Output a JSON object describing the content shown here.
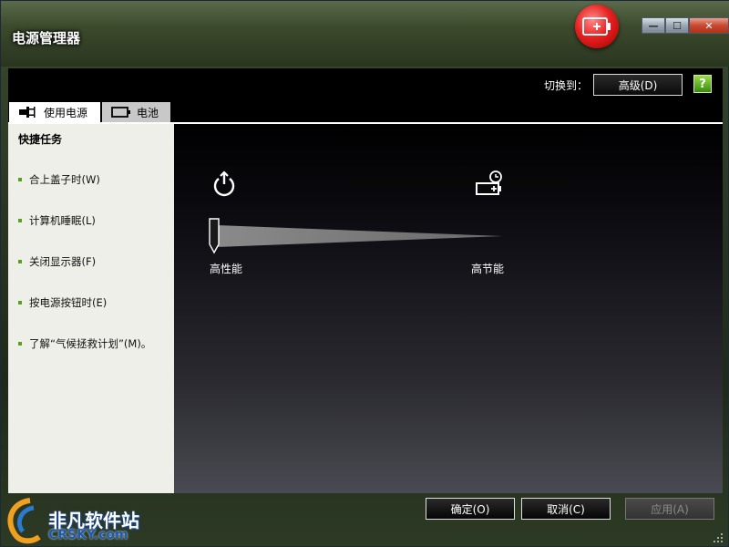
{
  "window": {
    "title": "电源管理器",
    "controls": {
      "minimize": "—",
      "maximize": "☐",
      "close": "✕"
    }
  },
  "header": {
    "switch_label": "切换到：",
    "advanced_button": "高级(D)",
    "help_icon": "?"
  },
  "tabs": [
    {
      "label": "使用电源",
      "icon": "power-plug-icon",
      "active": true
    },
    {
      "label": "电池",
      "icon": "battery-icon",
      "active": false
    }
  ],
  "sidebar": {
    "title": "快捷任务",
    "items": [
      {
        "label": "合上盖子时(W)"
      },
      {
        "label": "计算机睡眠(L)"
      },
      {
        "label": "关闭显示器(F)"
      },
      {
        "label": "按电源按钮时(E)"
      },
      {
        "label": "了解“气候拯救计划”(M)。"
      }
    ]
  },
  "main": {
    "slider": {
      "left_label": "高性能",
      "right_label": "高节能",
      "value": 0
    }
  },
  "footer": {
    "ok_button": "确定(O)",
    "cancel_button": "取消(C)",
    "apply_button": "应用(A)"
  },
  "watermark": {
    "text_cn": "非凡软件站",
    "text_en": "CRSKY.com"
  }
}
